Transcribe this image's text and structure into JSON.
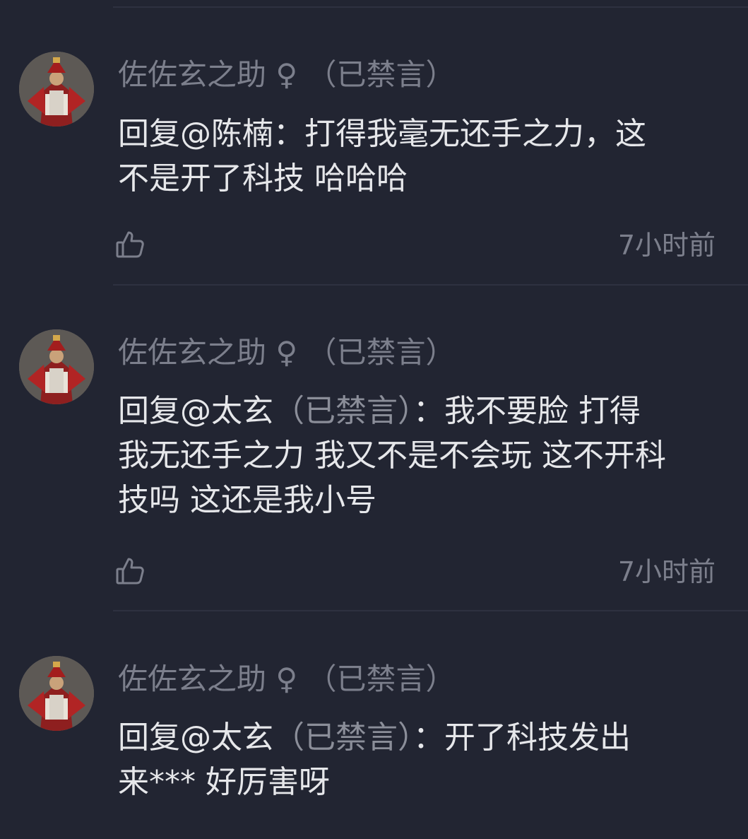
{
  "comments": [
    {
      "username": "佐佐玄之助",
      "gender": "♀",
      "status": "（已禁言）",
      "reply_prefix": "回复@陈楠",
      "reply_colon": "：",
      "text_line1": "打得我毫无还手之力，这",
      "text_line2": "不是开了科技 哈哈哈",
      "time": "7小时前"
    },
    {
      "username": "佐佐玄之助",
      "gender": "♀",
      "status": "（已禁言）",
      "reply_prefix": "回复@太玄",
      "reply_target_status": "（已禁言）",
      "reply_colon": "：",
      "text_line1": "我不要脸 打得",
      "text_line2": "我无还手之力 我又不是不会玩 这不开科",
      "text_line3": "技吗 这还是我小号",
      "time": "7小时前"
    },
    {
      "username": "佐佐玄之助",
      "gender": "♀",
      "status": "（已禁言）",
      "reply_prefix": "回复@太玄",
      "reply_target_status": "（已禁言）",
      "reply_colon": "：",
      "text_line1": "开了科技发出",
      "text_line2": "来*** 好厉害呀"
    }
  ],
  "icons": {
    "like": "thumbs-up-icon",
    "avatar": "avatar"
  },
  "colors": {
    "background": "#222532",
    "username": "#7c7f8c",
    "body_text": "#e6e7ea",
    "muted": "#8b8e99",
    "divider": "#2e3140"
  }
}
